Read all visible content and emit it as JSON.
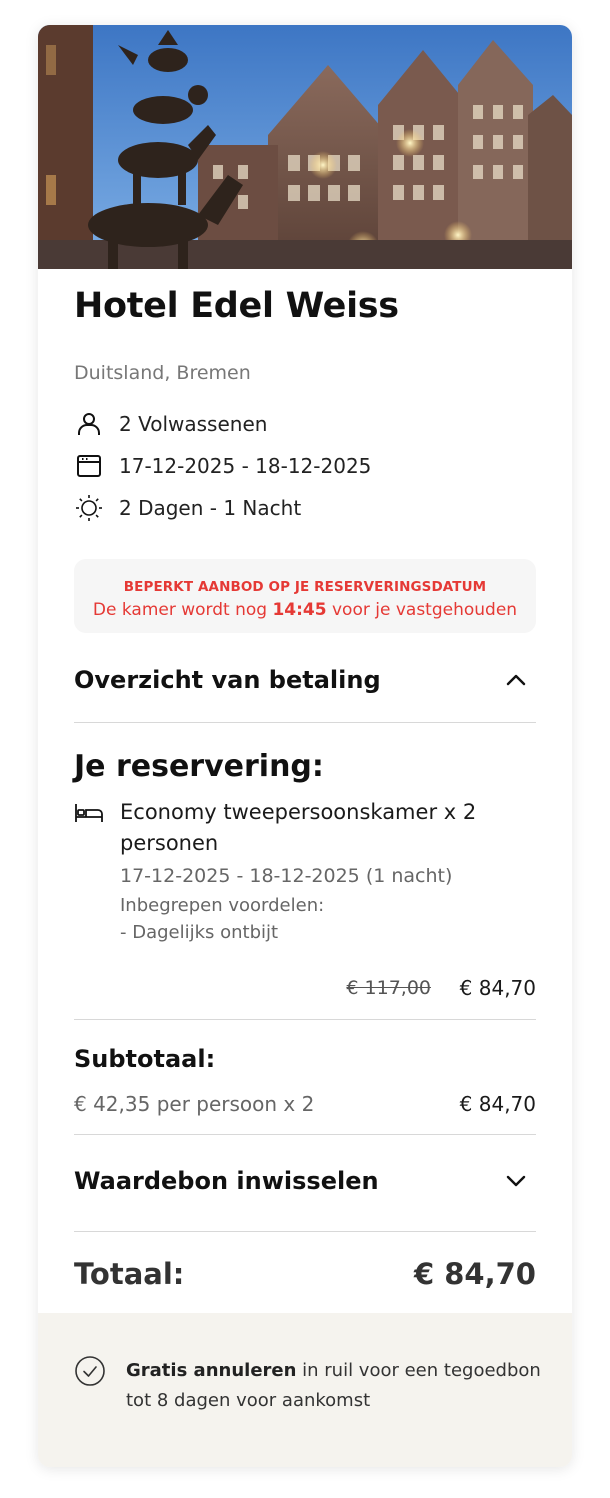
{
  "hotel": {
    "name": "Hotel Edel Weiss",
    "location": "Duitsland, Bremen"
  },
  "details": {
    "guests": "2 Volwassenen",
    "dates": "17-12-2025 - 18-12-2025",
    "duration": "2 Dagen - 1 Nacht"
  },
  "offer": {
    "headline": "BEPERKT AANBOD OP JE RESERVERINGSDATUM",
    "text_before": "De kamer wordt nog ",
    "timer": "14:45",
    "text_after": " voor je vastgehouden"
  },
  "payment_overview": {
    "label": "Overzicht van betaling",
    "expanded": true
  },
  "reservation": {
    "title": "Je reservering:",
    "room_name": "Economy tweepersoonskamer x 2 personen",
    "room_dates": "17-12-2025 - 18-12-2025 (1 nacht)",
    "included_label": "Inbegrepen voordelen:",
    "included_item": "- Dagelijks ontbijt",
    "price_old": "€ 117,00",
    "price_new": "€ 84,70"
  },
  "subtotal": {
    "label": "Subtotaal:",
    "detail": "€ 42,35 per persoon x 2",
    "amount": "€ 84,70"
  },
  "voucher": {
    "label": "Waardebon inwisselen",
    "expanded": false
  },
  "total": {
    "label": "Totaal:",
    "amount": "€ 84,70"
  },
  "footer": {
    "bold": "Gratis annuleren",
    "text": " in ruil voor een tegoedbon tot 8 dagen voor aankomst"
  },
  "icons": {
    "guests": "person-icon",
    "dates": "calendar-icon",
    "duration": "sun-icon",
    "room": "bed-icon",
    "cancel": "check-circle-icon"
  },
  "colors": {
    "accent_red": "#e53935",
    "footer_bg": "#f5f3ee",
    "offer_bg": "#f6f6f6"
  }
}
